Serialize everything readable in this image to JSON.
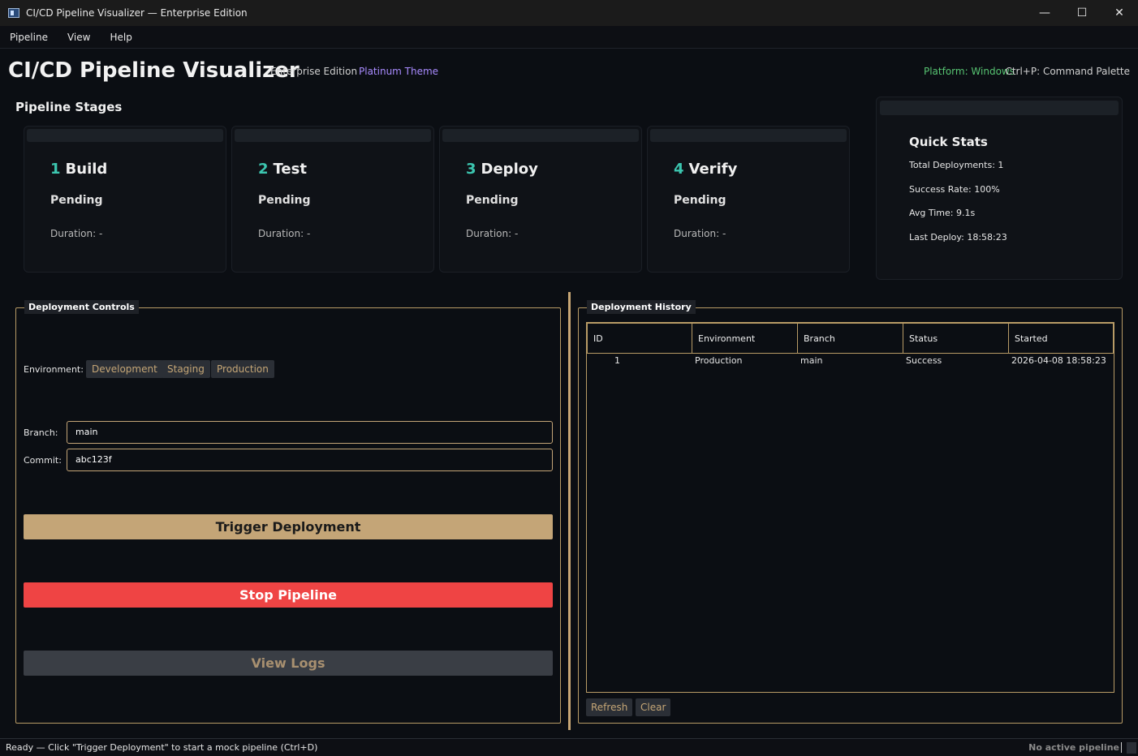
{
  "window": {
    "title": "CI/CD Pipeline Visualizer — Enterprise Edition",
    "minimize_glyph": "—",
    "maximize_glyph": "☐",
    "close_glyph": "✕"
  },
  "menu": [
    "Pipeline",
    "View",
    "Help"
  ],
  "header": {
    "title": "CI/CD Pipeline Visualizer",
    "edition": "Enterprise Edition",
    "theme": "Platinum Theme",
    "platform": "Platform: Windows",
    "palette_hint": "Ctrl+P: Command Palette"
  },
  "stages_title": "Pipeline Stages",
  "stages": [
    {
      "num": "1",
      "name": "Build",
      "status": "Pending",
      "duration": "Duration: -"
    },
    {
      "num": "2",
      "name": "Test",
      "status": "Pending",
      "duration": "Duration: -"
    },
    {
      "num": "3",
      "name": "Deploy",
      "status": "Pending",
      "duration": "Duration: -"
    },
    {
      "num": "4",
      "name": "Verify",
      "status": "Pending",
      "duration": "Duration: -"
    }
  ],
  "quick_stats": {
    "title": "Quick Stats",
    "total": "Total Deployments: 1",
    "success_rate": "Success Rate: 100%",
    "avg_time": "Avg Time: 9.1s",
    "last_deploy": "Last Deploy: 18:58:23"
  },
  "controls": {
    "legend": "Deployment Controls",
    "environment_label": "Environment:",
    "environments": [
      "Development",
      "Staging",
      "Production"
    ],
    "branch_label": "Branch:",
    "branch_value": "main",
    "commit_label": "Commit:",
    "commit_value": "abc123f",
    "trigger_label": "Trigger Deployment",
    "stop_label": "Stop Pipeline",
    "logs_label": "View Logs"
  },
  "history": {
    "legend": "Deployment History",
    "columns": [
      "ID",
      "Environment",
      "Branch",
      "Status",
      "Started"
    ],
    "rows": [
      {
        "id": "1",
        "environment": "Production",
        "branch": "main",
        "status": "Success",
        "started": "2026-04-08 18:58:23"
      }
    ],
    "refresh_label": "Refresh",
    "clear_label": "Clear"
  },
  "status_bar": {
    "message": "Ready — Click \"Trigger Deployment\" to start a mock pipeline (Ctrl+D)",
    "pipeline_state": "No active pipeline"
  },
  "colors": {
    "accent": "#c4a577",
    "danger": "#ef4444",
    "stage_number": "#3cc6b0",
    "theme_label": "#a98bff",
    "platform_label": "#57c472"
  }
}
